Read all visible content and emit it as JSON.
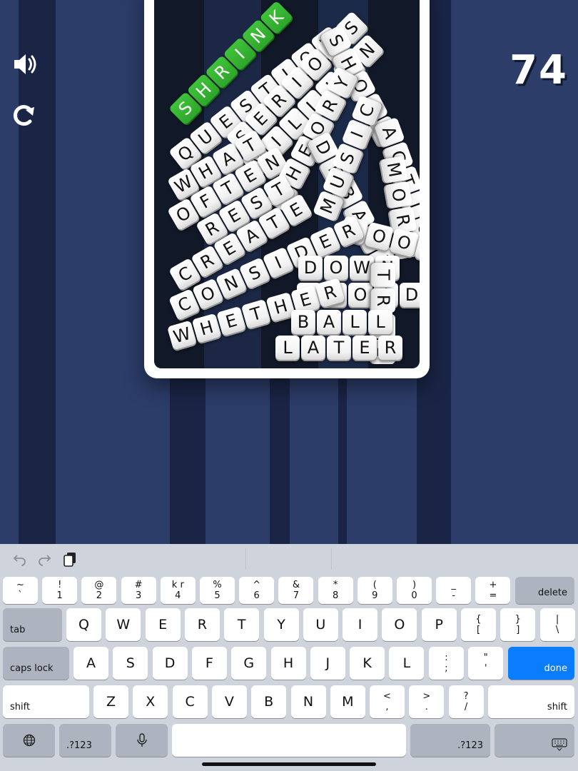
{
  "score": "74",
  "controls": {
    "sound_icon": "speaker-icon",
    "restart_icon": "restart-icon"
  },
  "colors": {
    "background": "#2c3d6a",
    "stripe_dark": "#1b2747",
    "board_frame": "#ffffff",
    "tile": "#f4f4f4",
    "tile_highlight": "#2ea62b",
    "done_key": "#0a7cff"
  },
  "words": [
    {
      "text": "SHRINK",
      "highlighted": true
    },
    {
      "text": "QUESTION",
      "highlighted": false
    },
    {
      "text": "SERIOUS",
      "highlighted": false
    },
    {
      "text": "MILLION",
      "highlighted": false
    },
    {
      "text": "SHOOT",
      "highlighted": false
    },
    {
      "text": "ACTION",
      "highlighted": false
    },
    {
      "text": "MORE",
      "highlighted": false
    },
    {
      "text": "WHAT",
      "highlighted": false
    },
    {
      "text": "OFTEN",
      "highlighted": false
    },
    {
      "text": "THEORY",
      "highlighted": false
    },
    {
      "text": "DEBATE",
      "highlighted": false
    },
    {
      "text": "MUSIC",
      "highlighted": false
    },
    {
      "text": "REST",
      "highlighted": false
    },
    {
      "text": "POOR",
      "highlighted": false
    },
    {
      "text": "CREATE",
      "highlighted": false
    },
    {
      "text": "CONSIDER",
      "highlighted": false
    },
    {
      "text": "DOWN",
      "highlighted": false
    },
    {
      "text": "AVOID",
      "highlighted": false
    },
    {
      "text": "TRUE",
      "highlighted": false
    },
    {
      "text": "WHETHER",
      "highlighted": false
    },
    {
      "text": "BALL",
      "highlighted": false
    },
    {
      "text": "LATER",
      "highlighted": false
    }
  ],
  "keyboard": {
    "toolbar": [
      "undo-icon",
      "redo-icon",
      "paste-icon"
    ],
    "number_row": [
      {
        "top": "~",
        "bottom": "`"
      },
      {
        "top": "!",
        "bottom": "1"
      },
      {
        "top": "@",
        "bottom": "2"
      },
      {
        "top": "#",
        "bottom": "3"
      },
      {
        "top": "k r",
        "bottom": "4"
      },
      {
        "top": "%",
        "bottom": "5"
      },
      {
        "top": "^",
        "bottom": "6"
      },
      {
        "top": "&",
        "bottom": "7"
      },
      {
        "top": "*",
        "bottom": "8"
      },
      {
        "top": "(",
        "bottom": "9"
      },
      {
        "top": ")",
        "bottom": "0"
      },
      {
        "top": "_",
        "bottom": "-"
      },
      {
        "top": "+",
        "bottom": "="
      }
    ],
    "delete": "delete",
    "tab": "tab",
    "row1": [
      "Q",
      "W",
      "E",
      "R",
      "T",
      "Y",
      "U",
      "I",
      "O",
      "P"
    ],
    "row1_symbols": [
      {
        "top": "{",
        "bottom": "["
      },
      {
        "top": "}",
        "bottom": "]"
      },
      {
        "top": "|",
        "bottom": "\\"
      }
    ],
    "caps_lock": "caps lock",
    "row2": [
      "A",
      "S",
      "D",
      "F",
      "G",
      "H",
      "J",
      "K",
      "L"
    ],
    "row2_symbols": [
      {
        "top": ":",
        "bottom": ";"
      },
      {
        "top": "\"",
        "bottom": "'"
      }
    ],
    "done": "done",
    "shift": "shift",
    "row3": [
      "Z",
      "X",
      "C",
      "V",
      "B",
      "N",
      "M"
    ],
    "row3_symbols": [
      {
        "top": "<",
        "bottom": ","
      },
      {
        "top": ">",
        "bottom": "."
      },
      {
        "top": "?",
        "bottom": "/"
      }
    ],
    "numbers_key": ".?123",
    "bottom_icons": [
      "globe-icon",
      "microphone-icon",
      "keyboard-hide-icon"
    ]
  }
}
